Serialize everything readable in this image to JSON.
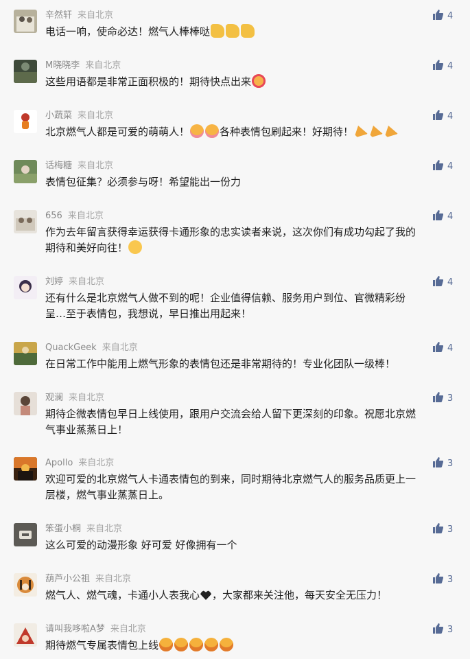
{
  "comments": [
    {
      "name": "辛然轩",
      "location": "来自北京",
      "likes": "4",
      "text": "电话一响，使命必达！燃气人棒棒哒",
      "emojis": [
        "e-thumb",
        "e-thumb",
        "e-thumb"
      ],
      "text2": ""
    },
    {
      "name": "M晓晓李",
      "location": "来自北京",
      "likes": "4",
      "text": "这些用语都是非常正面积极的！期待快点出来",
      "emojis": [
        "e-love"
      ],
      "text2": ""
    },
    {
      "name": "小蔬菜",
      "location": "来自北京",
      "likes": "4",
      "text": "北京燃气人都是可爱的萌萌人！",
      "emojis": [
        "e-blush",
        "e-blush"
      ],
      "text2": "各种表情包刷起来！好期待！",
      "emojis2": [
        "e-party",
        "e-party",
        "e-party"
      ]
    },
    {
      "name": "话梅糖",
      "location": "来自北京",
      "likes": "4",
      "text": "表情包征集？必须参与呀！希望能出一份力",
      "emojis": [],
      "text2": ""
    },
    {
      "name": "656",
      "location": "来自北京",
      "likes": "4",
      "text": "作为去年留言获得幸运获得卡通形象的忠实读者来说，这次你们有成功勾起了我的",
      "line2": "期待和美好向往！",
      "emojis2": [
        "e-smile"
      ]
    },
    {
      "name": "刘婷",
      "location": "来自北京",
      "likes": "4",
      "text": "还有什么是北京燃气人做不到的呢！企业值得信赖、服务用户到位、官微精彩纷",
      "line2": "呈…至于表情包，我想说，早日推出用起来！",
      "emojis2": []
    },
    {
      "name": "QuackGeek",
      "location": "来自北京",
      "likes": "4",
      "text": "在日常工作中能用上燃气形象的表情包还是非常期待的！专业化团队一级棒！",
      "emojis": []
    },
    {
      "name": "观澜",
      "location": "来自北京",
      "likes": "3",
      "text": "期待企微表情包早日上线使用，跟用户交流会给人留下更深刻的印象。祝愿北京燃",
      "line2": "气事业蒸蒸日上！",
      "emojis2": []
    },
    {
      "name": "Apollo",
      "location": "来自北京",
      "likes": "3",
      "text": "欢迎可爱的北京燃气人卡通表情包的到来，同时期待北京燃气人的服务品质更上一",
      "line2": "层楼，燃气事业蒸蒸日上。",
      "emojis2": []
    },
    {
      "name": "笨蛋小桐",
      "location": "来自北京",
      "likes": "3",
      "text": "这么可爱的动漫形象  好可爱  好像拥有一个",
      "emojis": []
    },
    {
      "name": "葫芦小公祖",
      "location": "来自北京",
      "likes": "3",
      "text": "燃气人、燃气魂，卡通小人表我心",
      "emojis": [
        "e-heart"
      ],
      "text2": "，大家都来关注他，每天安全无压力！"
    },
    {
      "name": "请叫我哆啦A梦",
      "location": "来自北京",
      "likes": "3",
      "text": "期待燃气专属表情包上线",
      "emojis": [
        "e-shock",
        "e-shock",
        "e-shock",
        "e-shock",
        "e-shock"
      ],
      "text2": ""
    }
  ],
  "colors": {
    "name": "#8a8a8a",
    "like": "#576b95",
    "text": "#1f1f1f",
    "background": "#f7f7f7"
  }
}
